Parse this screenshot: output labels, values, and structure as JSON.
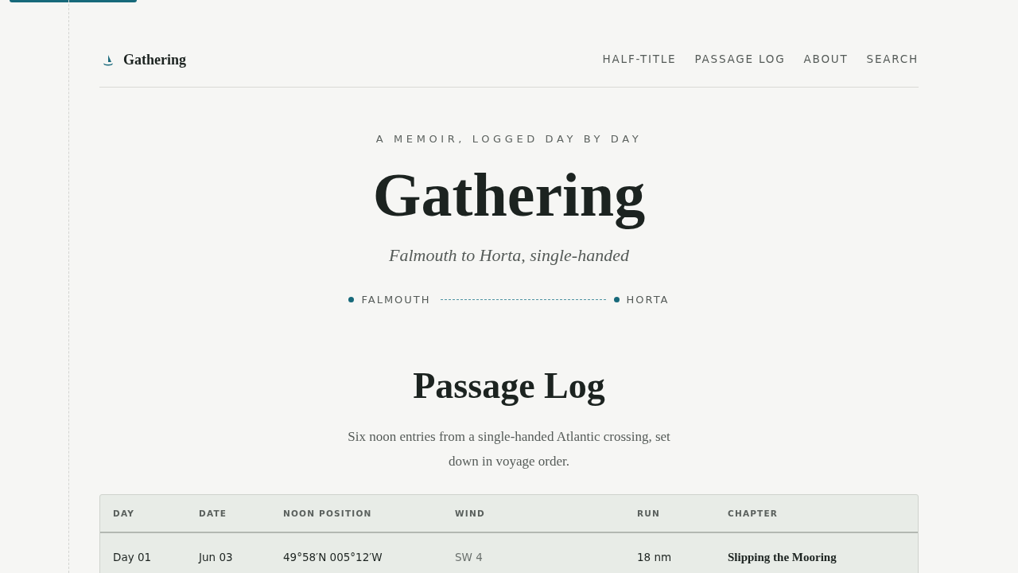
{
  "header": {
    "brand": "Gathering",
    "nav": [
      {
        "label": "HALF-TITLE"
      },
      {
        "label": "PASSAGE LOG"
      },
      {
        "label": "ABOUT"
      },
      {
        "label": "SEARCH"
      }
    ]
  },
  "hero": {
    "kicker": "A MEMOIR, LOGGED DAY BY DAY",
    "title": "Gathering",
    "subtitle": "Falmouth to Horta, single-handed",
    "route": {
      "from": "FALMOUTH",
      "to": "HORTA"
    }
  },
  "section": {
    "title": "Passage Log",
    "intro": "Six noon entries from a single-handed Atlantic crossing, set down in voyage order."
  },
  "table": {
    "columns": [
      {
        "label": "DAY",
        "kind": "plain"
      },
      {
        "label": "DATE",
        "kind": "plain"
      },
      {
        "label": "NOON POSITION",
        "kind": "plain"
      },
      {
        "label": "WIND",
        "kind": "muted"
      },
      {
        "label": "RUN",
        "kind": "plain"
      },
      {
        "label": "CHAPTER",
        "kind": "title"
      }
    ],
    "rows": [
      [
        "Day 01",
        "Jun 03",
        "49°58′N 005°12′W",
        "SW 4",
        "18 nm",
        "Slipping the Mooring"
      ]
    ]
  }
}
